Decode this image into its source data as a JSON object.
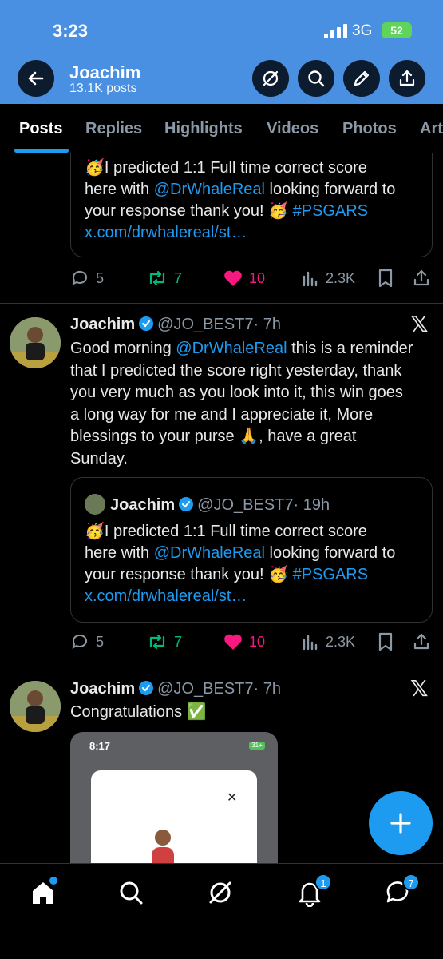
{
  "status_bar": {
    "time": "3:23",
    "network": "3G",
    "battery": "52"
  },
  "header": {
    "name": "Joachim",
    "posts": "13.1K posts"
  },
  "tabs": [
    "Posts",
    "Replies",
    "Highlights",
    "Videos",
    "Photos",
    "Art"
  ],
  "quote1": {
    "lines": [
      "🥳I predicted 1:1 Full time correct score",
      "here with ",
      "@DrWhaleReal",
      " looking forward to",
      "your response thank you! 🥳 ",
      "#PSGARS",
      "x.com/drwhalereal/st…"
    ]
  },
  "actions1": {
    "replies": "5",
    "reposts": "7",
    "likes": "10",
    "views": "2.3K"
  },
  "post2": {
    "name": "Joachim",
    "handle": "@JO_BEST7",
    "time": "· 7h",
    "text_lines": [
      "Good morning ",
      "@DrWhaleReal",
      " this is a reminder",
      "that I predicted the score right yesterday, thank",
      "you very much as you look into it, this win goes",
      "a long way for me and I appreciate it, More",
      "blessings to your purse 🙏, have a great",
      "Sunday."
    ],
    "quote": {
      "name": "Joachim",
      "handle": "@JO_BEST7",
      "time": "· 19h",
      "lines": [
        "🥳I predicted 1:1 Full time correct score",
        "here with ",
        "@DrWhaleReal",
        " looking forward to",
        "your response thank you! 🥳 ",
        "#PSGARS",
        "x.com/drwhalereal/st…"
      ]
    },
    "actions": {
      "replies": "5",
      "reposts": "7",
      "likes": "10",
      "views": "2.3K"
    }
  },
  "post3": {
    "name": "Joachim",
    "handle": "@JO_BEST7",
    "time": "· 7h",
    "text": "Congratulations ✅",
    "embed_time": "8:17",
    "embed_battery": "31+"
  },
  "bottom_nav": {
    "notifications_badge": "1",
    "messages_badge": "7"
  },
  "colors": {
    "header": "#4a90e2",
    "accent": "#1d9bf0",
    "repost": "#00ba7c",
    "like": "#f91880"
  },
  "icons": [
    "back-arrow-icon",
    "no-grok-icon",
    "search-icon",
    "edit-icon",
    "share-icon",
    "reply-icon",
    "repost-icon",
    "like-icon",
    "views-icon",
    "bookmark-icon",
    "x-logo-icon",
    "home-icon",
    "grok-icon",
    "bell-icon",
    "messages-icon",
    "plus-icon"
  ]
}
